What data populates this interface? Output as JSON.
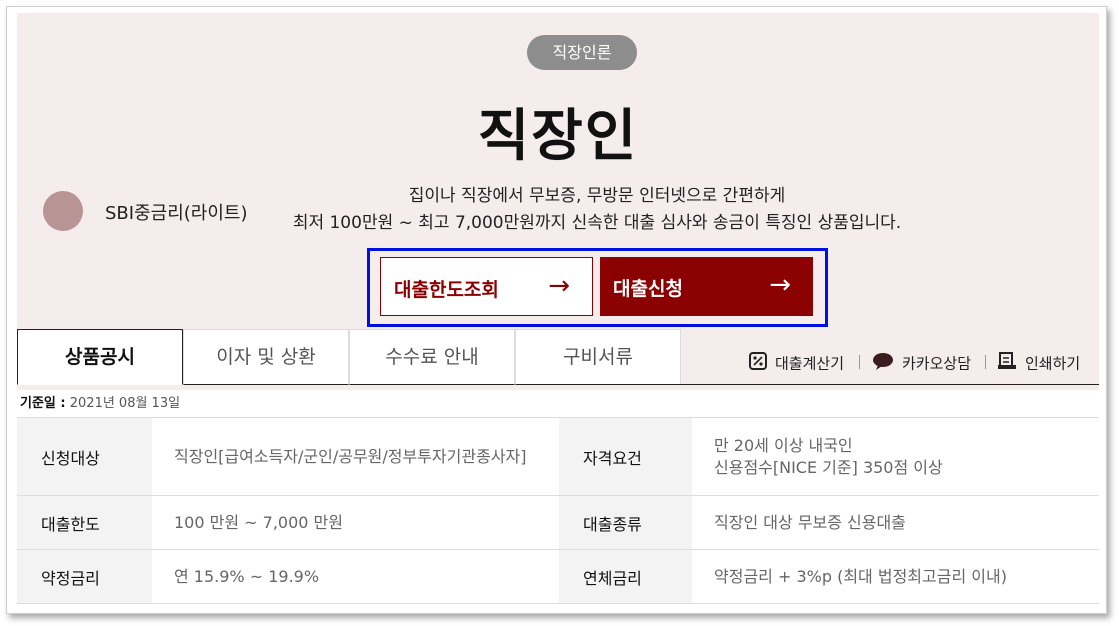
{
  "hero": {
    "category": "직장인론",
    "title": "직장인",
    "brand": "SBI중금리(라이트)",
    "description": [
      "집이나 직장에서 무보증, 무방문 인터넷으로 간편하게",
      "최저 100만원 ~ 최고 7,000만원까지 신속한 대출 심사와 송금이 특징인 상품입니다."
    ],
    "buttons": {
      "limit": {
        "label": "대출한도조회",
        "arrow": "→"
      },
      "apply": {
        "label": "대출신청",
        "arrow": "→"
      }
    },
    "colors": {
      "background": "#f5ecec",
      "brand": "#8b0000",
      "highlight": "#0010e0"
    }
  },
  "tabs": [
    {
      "label": "상품공시",
      "active": true
    },
    {
      "label": "이자 및 상환",
      "active": false
    },
    {
      "label": "수수료 안내",
      "active": false
    },
    {
      "label": "구비서류",
      "active": false
    }
  ],
  "tools": [
    {
      "label": "대출계산기",
      "icon": "percent-calculator-icon"
    },
    {
      "label": "카카오상담",
      "icon": "chat-bubble-icon"
    },
    {
      "label": "인쇄하기",
      "icon": "printer-icon"
    }
  ],
  "base_date": {
    "label": "기준일 :",
    "value": "2021년 08월 13일"
  },
  "table": [
    {
      "left": {
        "label": "신청대상",
        "value": [
          "직장인[급여소득자/군인/공무원/정부투자기관종사자]"
        ]
      },
      "right": {
        "label": "자격요건",
        "value": [
          "만 20세 이상 내국인",
          "신용점수[NICE 기준] 350점 이상"
        ]
      }
    },
    {
      "left": {
        "label": "대출한도",
        "value": [
          "100 만원 ~ 7,000 만원"
        ]
      },
      "right": {
        "label": "대출종류",
        "value": [
          "직장인 대상 무보증 신용대출"
        ]
      }
    },
    {
      "left": {
        "label": "약정금리",
        "value": [
          "연 15.9% ~ 19.9%"
        ]
      },
      "right": {
        "label": "연체금리",
        "value": [
          "약정금리 + 3%p (최대 법정최고금리 이내)"
        ]
      }
    }
  ]
}
